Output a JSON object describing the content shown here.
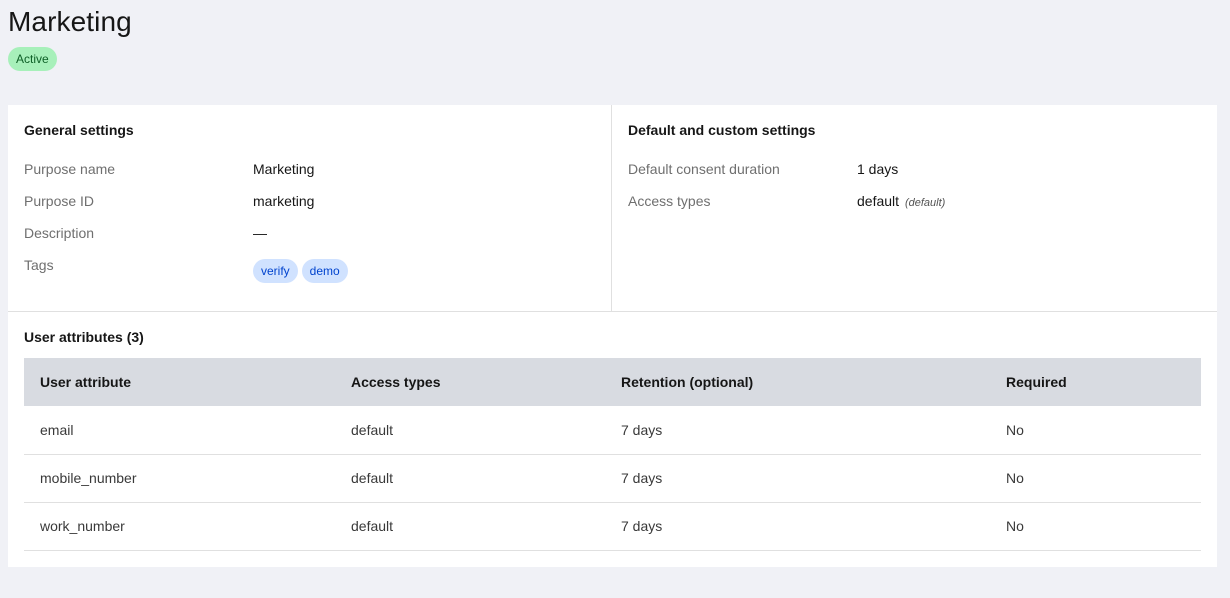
{
  "header": {
    "title": "Marketing",
    "status": "Active"
  },
  "general_settings": {
    "heading": "General settings",
    "purpose_name_label": "Purpose name",
    "purpose_name_value": "Marketing",
    "purpose_id_label": "Purpose ID",
    "purpose_id_value": "marketing",
    "description_label": "Description",
    "description_value": "—",
    "tags_label": "Tags",
    "tags": [
      "verify",
      "demo"
    ]
  },
  "default_settings": {
    "heading": "Default and custom settings",
    "consent_duration_label": "Default consent duration",
    "consent_duration_value": "1 days",
    "access_types_label": "Access types",
    "access_types_value": "default",
    "access_types_note": "(default)"
  },
  "user_attributes": {
    "heading": "User attributes (3)",
    "columns": [
      "User attribute",
      "Access types",
      "Retention (optional)",
      "Required"
    ],
    "rows": [
      [
        "email",
        "default",
        "7 days",
        "No"
      ],
      [
        "mobile_number",
        "default",
        "7 days",
        "No"
      ],
      [
        "work_number",
        "default",
        "7 days",
        "No"
      ]
    ]
  },
  "colors": {
    "page_background": "#f0f1f6",
    "status_badge_bg": "#a7f0ba",
    "status_badge_text": "#0e6027",
    "tag_bg": "#d0e2ff",
    "tag_text": "#0043ce",
    "table_header_bg": "#d8dbe1"
  }
}
